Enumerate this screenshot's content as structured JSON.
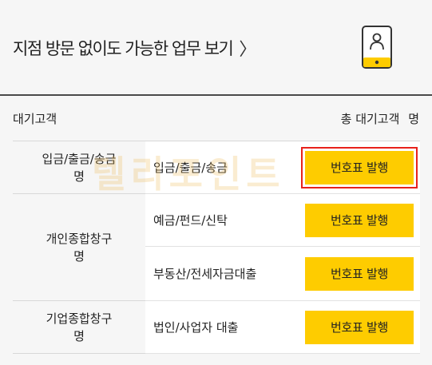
{
  "banner": {
    "title": "지점 방문 없이도 가능한 업무 보기",
    "chevron": "〉",
    "icon": "mobile-phone-user-icon"
  },
  "summary": {
    "label": "대기고객",
    "total_label": "총 대기고객",
    "total_unit": "명"
  },
  "groups": [
    {
      "category": "입금/출금/송금",
      "count_unit": "명",
      "services": [
        {
          "label": "입금/출금/송금",
          "button": "번호표 발행"
        }
      ]
    },
    {
      "category": "개인종합창구",
      "count_unit": "명",
      "services": [
        {
          "label": "예금/펀드/신탁",
          "button": "번호표 발행"
        },
        {
          "label": "부동산/전세자금대출",
          "button": "번호표 발행"
        }
      ]
    },
    {
      "category": "기업종합창구",
      "count_unit": "명",
      "services": [
        {
          "label": "법인/사업자 대출",
          "button": "번호표 발행"
        }
      ]
    }
  ],
  "watermark": "텔리포인트",
  "colors": {
    "button": "#fecc00",
    "highlight": "#e8221b",
    "background": "#f6f6f6"
  }
}
